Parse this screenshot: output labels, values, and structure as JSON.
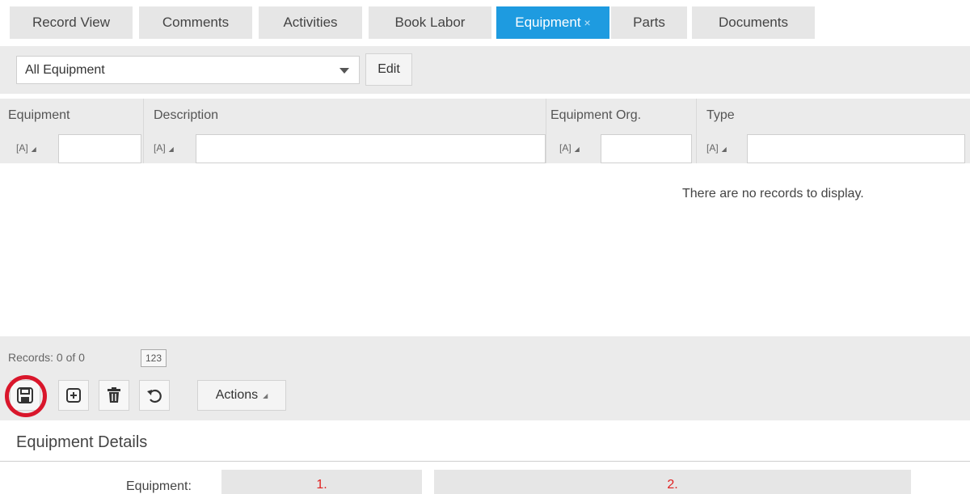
{
  "tabs": [
    {
      "label": "Record View",
      "active": false
    },
    {
      "label": "Comments",
      "active": false
    },
    {
      "label": "Activities",
      "active": false
    },
    {
      "label": "Book Labor",
      "active": false
    },
    {
      "label": "Equipment",
      "active": true,
      "close": "×"
    },
    {
      "label": "Parts",
      "active": false
    },
    {
      "label": "Documents",
      "active": false
    }
  ],
  "dataspy": {
    "selected": "All Equipment",
    "edit_label": "Edit"
  },
  "grid": {
    "columns": [
      {
        "label": "Equipment",
        "operator": "[A]"
      },
      {
        "label": "Description",
        "operator": "[A]"
      },
      {
        "label": "Equipment Org.",
        "operator": "[A]"
      },
      {
        "label": "Type",
        "operator": "[A]"
      }
    ],
    "empty_message": "There are no records to display."
  },
  "toolbar": {
    "records_text": "Records: 0 of 0",
    "number_button": "123",
    "actions_label": "Actions",
    "icons": [
      "save-icon",
      "new-record-icon",
      "delete-icon",
      "undo-icon"
    ],
    "highlight_color": "#d9162b"
  },
  "details": {
    "title": "Equipment Details",
    "equipment_label": "Equipment:",
    "field1_marker": "1.",
    "field2_marker": "2."
  },
  "colors": {
    "active_tab": "#1e9be0",
    "marker_text": "#e02020"
  }
}
